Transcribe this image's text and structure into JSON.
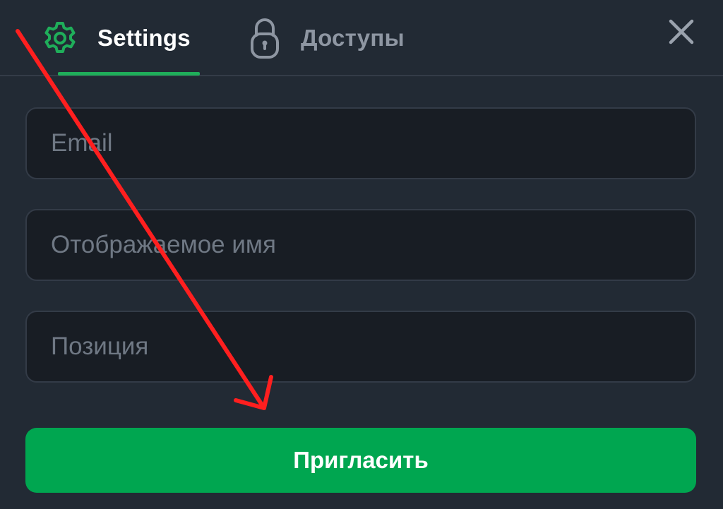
{
  "tabs": [
    {
      "label": "Settings",
      "icon": "gear-icon",
      "active": true
    },
    {
      "label": "Доступы",
      "icon": "lock-icon",
      "active": false
    }
  ],
  "close": {
    "icon": "close-icon"
  },
  "form": {
    "email": {
      "value": "",
      "placeholder": "Email"
    },
    "display_name": {
      "value": "",
      "placeholder": "Отображаемое имя"
    },
    "position": {
      "value": "",
      "placeholder": "Позиция"
    },
    "submit_label": "Пригласить"
  },
  "colors": {
    "background": "#222a34",
    "field_background": "#181d24",
    "accent": "#00a650",
    "active_tab_indicator": "#1fae5a",
    "inactive_text": "#8e96a2",
    "annotation_arrow": "#ff1f1f"
  },
  "annotation": {
    "type": "arrow",
    "color": "red",
    "points_to": "invite-button"
  }
}
